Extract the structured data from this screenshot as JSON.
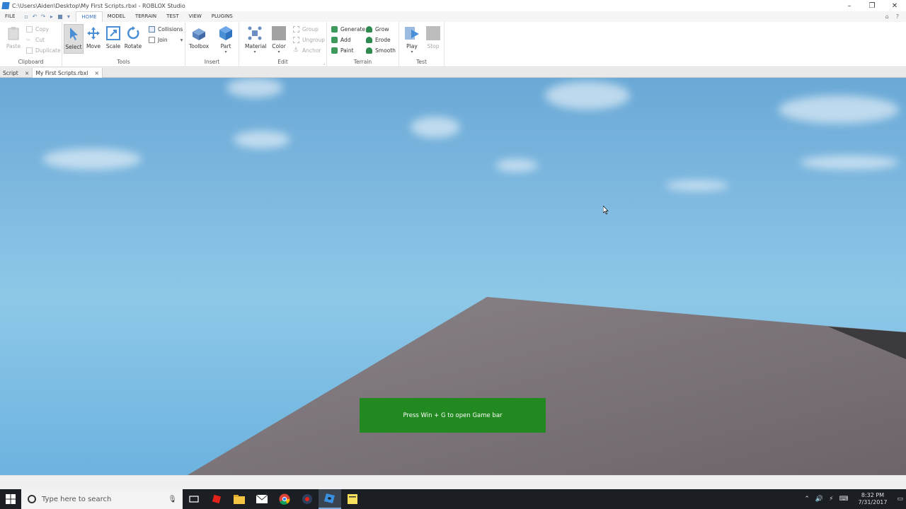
{
  "window": {
    "title": "C:\\Users\\Aiden\\Desktop\\My First Scripts.rbxl - ROBLOX Studio"
  },
  "menu": {
    "file": "FILE",
    "tabs": [
      "HOME",
      "MODEL",
      "TERRAIN",
      "TEST",
      "VIEW",
      "PLUGINS"
    ]
  },
  "ribbon": {
    "clipboard": {
      "label": "Clipboard",
      "paste": "Paste",
      "copy": "Copy",
      "cut": "Cut",
      "duplicate": "Duplicate"
    },
    "tools": {
      "label": "Tools",
      "select": "Select",
      "move": "Move",
      "scale": "Scale",
      "rotate": "Rotate",
      "collisions": "Collisions",
      "join": "Join"
    },
    "insert": {
      "label": "Insert",
      "toolbox": "Toolbox",
      "part": "Part"
    },
    "edit": {
      "label": "Edit",
      "material": "Material",
      "color": "Color",
      "group": "Group",
      "ungroup": "Ungroup",
      "anchor": "Anchor"
    },
    "terrain": {
      "label": "Terrain",
      "generate": "Generate",
      "add": "Add",
      "paint": "Paint",
      "grow": "Grow",
      "erode": "Erode",
      "smooth": "Smooth"
    },
    "test": {
      "label": "Test",
      "play": "Play",
      "stop": "Stop"
    }
  },
  "doc_tabs": [
    {
      "label": "Script"
    },
    {
      "label": "My First Scripts.rbxl"
    }
  ],
  "viewport": {
    "gamebar_text": "Press Win + G to open Game bar"
  },
  "taskbar": {
    "search_placeholder": "Type here to search",
    "time": "8:32 PM",
    "date": "7/31/2017"
  },
  "colors": {
    "accent": "#3a78c8",
    "gamebar": "#21891f",
    "taskbar": "#1b1f24"
  }
}
